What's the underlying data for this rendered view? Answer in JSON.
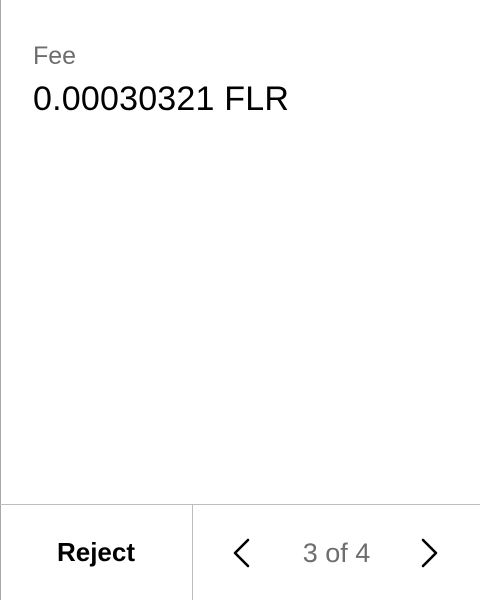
{
  "fee": {
    "label": "Fee",
    "value": "0.00030321 FLR"
  },
  "footer": {
    "reject_label": "Reject",
    "pagination": {
      "text": "3 of 4",
      "current": 3,
      "total": 4,
      "prev_icon": "chevron-left-icon",
      "next_icon": "chevron-right-icon"
    }
  },
  "colors": {
    "text_primary": "#000000",
    "text_secondary": "#6e6e6e",
    "divider": "#bdbdbd"
  }
}
